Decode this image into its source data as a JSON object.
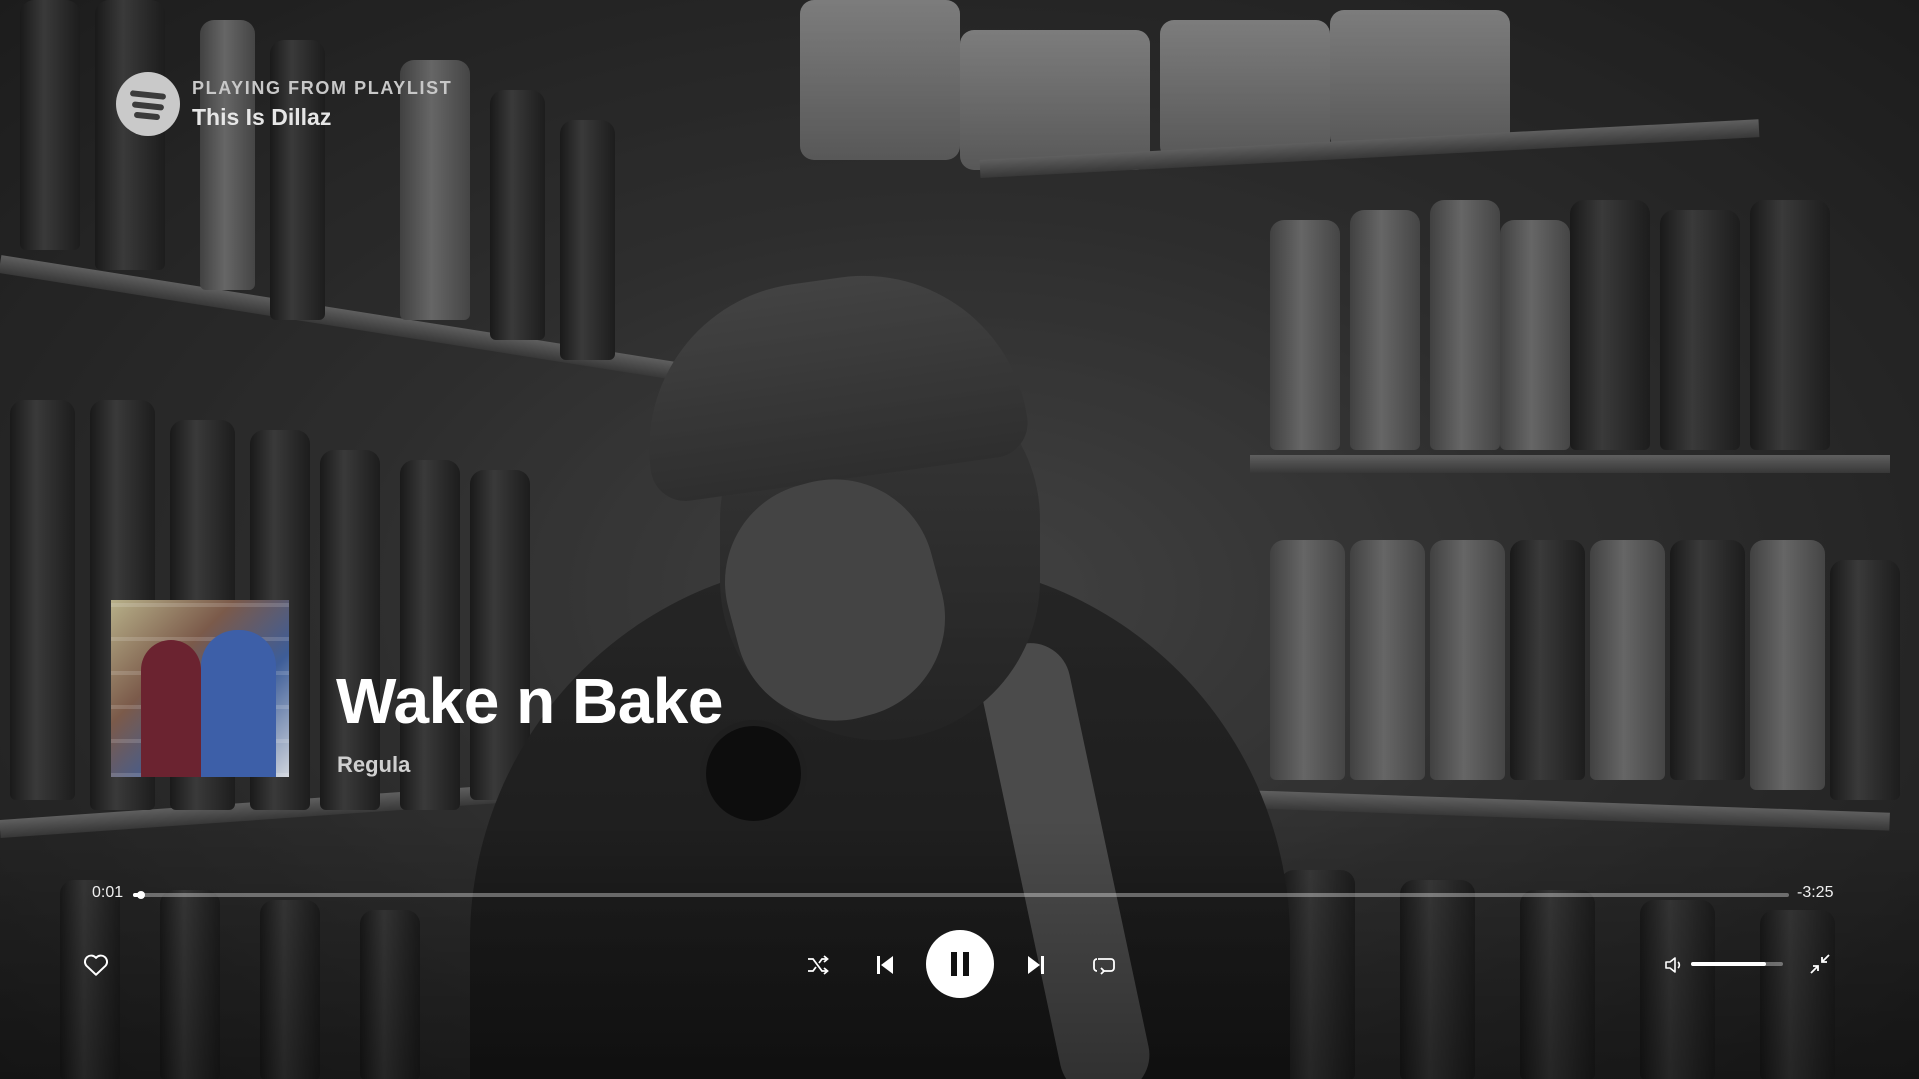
{
  "context": {
    "label": "PLAYING FROM PLAYLIST",
    "name": "This Is Dillaz"
  },
  "track": {
    "title": "Wake n Bake",
    "artist": "Regula"
  },
  "playback": {
    "elapsed": "0:01",
    "remaining": "-3:25",
    "progress_fraction": 0.005,
    "volume_fraction": 0.82,
    "state": "playing"
  },
  "icons": {
    "logo": "spotify-logo",
    "like": "heart-icon",
    "shuffle": "shuffle-icon",
    "previous": "skip-previous-icon",
    "play_pause": "pause-icon",
    "next": "skip-next-icon",
    "repeat": "repeat-icon",
    "volume": "volume-icon",
    "exit_fullscreen": "collapse-icon"
  },
  "colors": {
    "text_primary": "#ffffff",
    "text_secondary": "#cfcfcf",
    "track_background": "rgba(255,255,255,0.35)"
  }
}
